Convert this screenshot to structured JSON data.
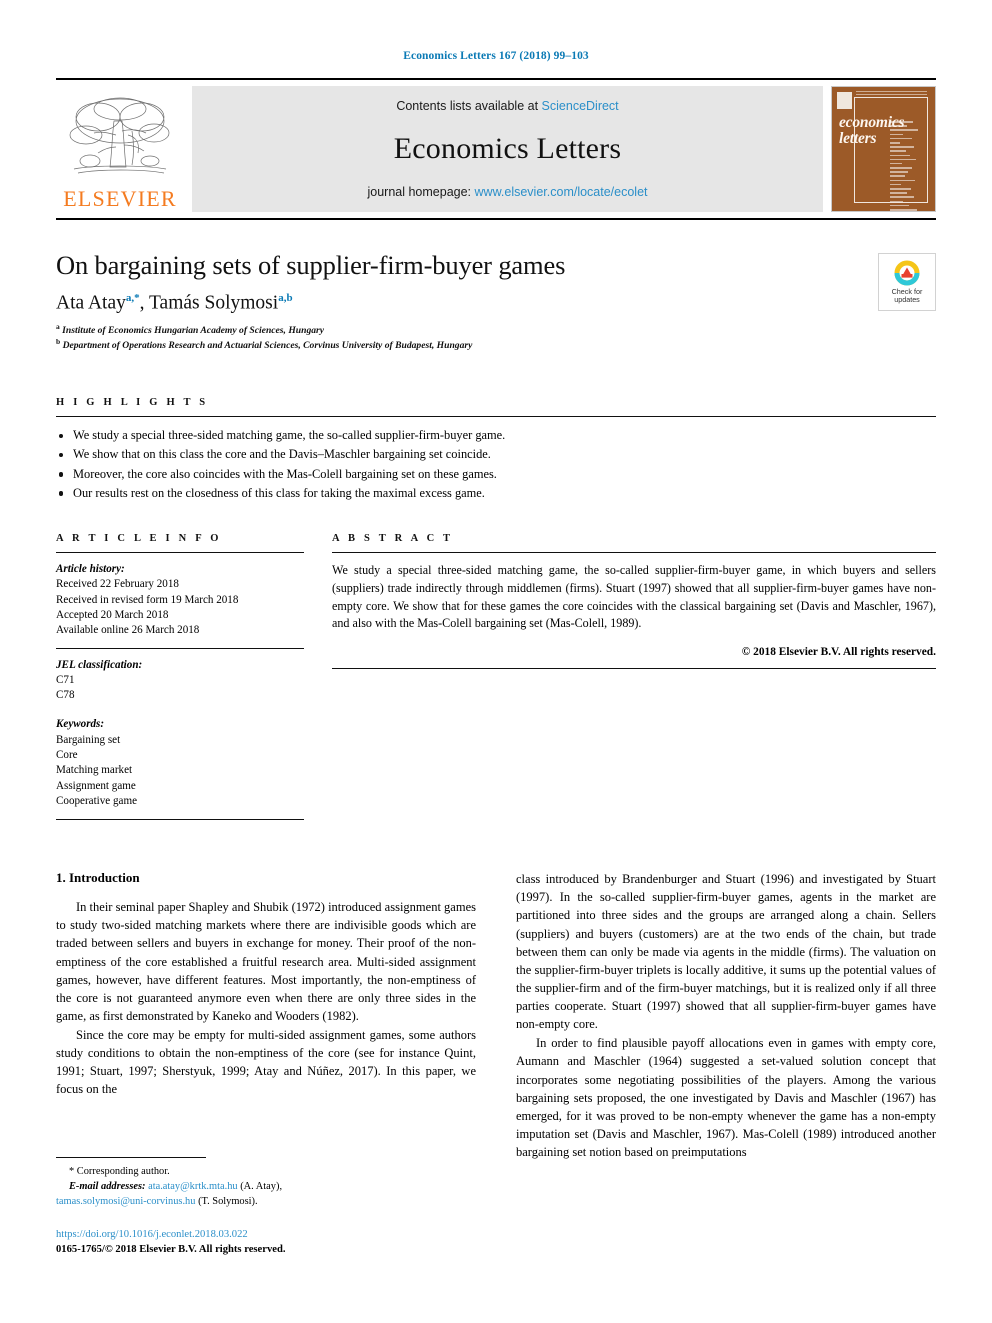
{
  "running_head": "Economics Letters 167 (2018) 99–103",
  "masthead": {
    "publisher_wordmark": "ELSEVIER",
    "contents_prefix": "Contents lists available at",
    "contents_link": "ScienceDirect",
    "journal_title": "Economics Letters",
    "homepage_prefix": "journal homepage:",
    "homepage_link": "www.elsevier.com/locate/ecolet",
    "cover_title_line1": "economics",
    "cover_title_line2": "letters"
  },
  "article": {
    "title": "On bargaining sets of supplier-firm-buyer games",
    "authors": "Ata Atay",
    "author1_sup": "a,*",
    "authors2": ", Tamás Solymosi",
    "author2_sup": "a,b",
    "affiliation_a_marker": "a",
    "affiliation_a": "Institute of Economics Hungarian Academy of Sciences, Hungary",
    "affiliation_b_marker": "b",
    "affiliation_b": "Department of Operations Research and Actuarial Sciences, Corvinus University of Budapest, Hungary"
  },
  "crossmark": {
    "line1": "Check for",
    "line2": "updates"
  },
  "highlights": {
    "heading": "H I G H L I G H T S",
    "items": [
      "We study a special three-sided matching game, the so-called supplier-firm-buyer game.",
      "We show that on this class the core and the Davis–Maschler bargaining set coincide.",
      "Moreover, the core also coincides with the Mas-Colell bargaining set on these games.",
      "Our results rest on the closedness of this class for taking the maximal excess game."
    ]
  },
  "article_info": {
    "heading": "A R T I C L E   I N F O",
    "history_label": "Article history:",
    "history": [
      "Received 22 February 2018",
      "Received in revised form 19 March 2018",
      "Accepted 20 March 2018",
      "Available online 26 March 2018"
    ],
    "jel_label": "JEL classification:",
    "jel_codes": [
      "C71",
      "C78"
    ],
    "keywords_label": "Keywords:",
    "keywords": [
      "Bargaining set",
      "Core",
      "Matching market",
      "Assignment game",
      "Cooperative game"
    ]
  },
  "abstract": {
    "heading": "A B S T R A C T",
    "text": "We study a special three-sided matching game, the so-called supplier-firm-buyer game, in which buyers and sellers (suppliers) trade indirectly through middlemen (firms). Stuart (1997) showed that all supplier-firm-buyer games have non-empty core. We show that for these games the core coincides with the classical bargaining set (Davis and Maschler, 1967), and also with the Mas-Colell bargaining set (Mas-Colell, 1989).",
    "copyright": "© 2018 Elsevier B.V. All rights reserved."
  },
  "introduction": {
    "heading": "1. Introduction",
    "left_paragraphs": [
      "In their seminal paper Shapley and Shubik (1972) introduced assignment games to study two-sided matching markets where there are indivisible goods which are traded between sellers and buyers in exchange for money. Their proof of the non-emptiness of the core established a fruitful research area. Multi-sided assignment games, however, have different features. Most importantly, the non-emptiness of the core is not guaranteed anymore even when there are only three sides in the game, as first demonstrated by Kaneko and Wooders (1982).",
      "Since the core may be empty for multi-sided assignment games, some authors study conditions to obtain the non-emptiness of the core (see for instance Quint, 1991; Stuart, 1997; Sherstyuk, 1999; Atay and Núñez, 2017). In this paper, we focus on the"
    ],
    "right_paragraphs": [
      "class introduced by Brandenburger and Stuart (1996) and investigated by Stuart (1997). In the so-called supplier-firm-buyer games, agents in the market are partitioned into three sides and the groups are arranged along a chain. Sellers (suppliers) and buyers (customers) are at the two ends of the chain, but trade between them can only be made via agents in the middle (firms). The valuation on the supplier-firm-buyer triplets is locally additive, it sums up the potential values of the supplier-firm and of the firm-buyer matchings, but it is realized only if all three parties cooperate. Stuart (1997) showed that all supplier-firm-buyer games have non-empty core.",
      "In order to find plausible payoff allocations even in games with empty core, Aumann and Maschler (1964) suggested a set-valued solution concept that incorporates some negotiating possibilities of the players. Among the various bargaining sets proposed, the one investigated by Davis and Maschler (1967) has emerged, for it was proved to be non-empty whenever the game has a non-empty imputation set (Davis and Maschler, 1967). Mas-Colell (1989) introduced another bargaining set notion based on preimputations"
    ]
  },
  "footnote": {
    "corresponding": "* Corresponding author.",
    "email_label": "E-mail addresses:",
    "email1": "ata.atay@krtk.mta.hu",
    "email1_name": "(A. Atay),",
    "email2": "tamas.solymosi@uni-corvinus.hu",
    "email2_name": "(T. Solymosi).",
    "doi": "https://doi.org/10.1016/j.econlet.2018.03.022",
    "issn_line": "0165-1765/© 2018 Elsevier B.V. All rights reserved."
  },
  "colors": {
    "link": "#2b8fc9",
    "running_head": "#0b7ab5",
    "elsevier_orange": "#F47B20",
    "cover_brown": "#9c5a28",
    "banner_grey": "#e6e6e6"
  }
}
